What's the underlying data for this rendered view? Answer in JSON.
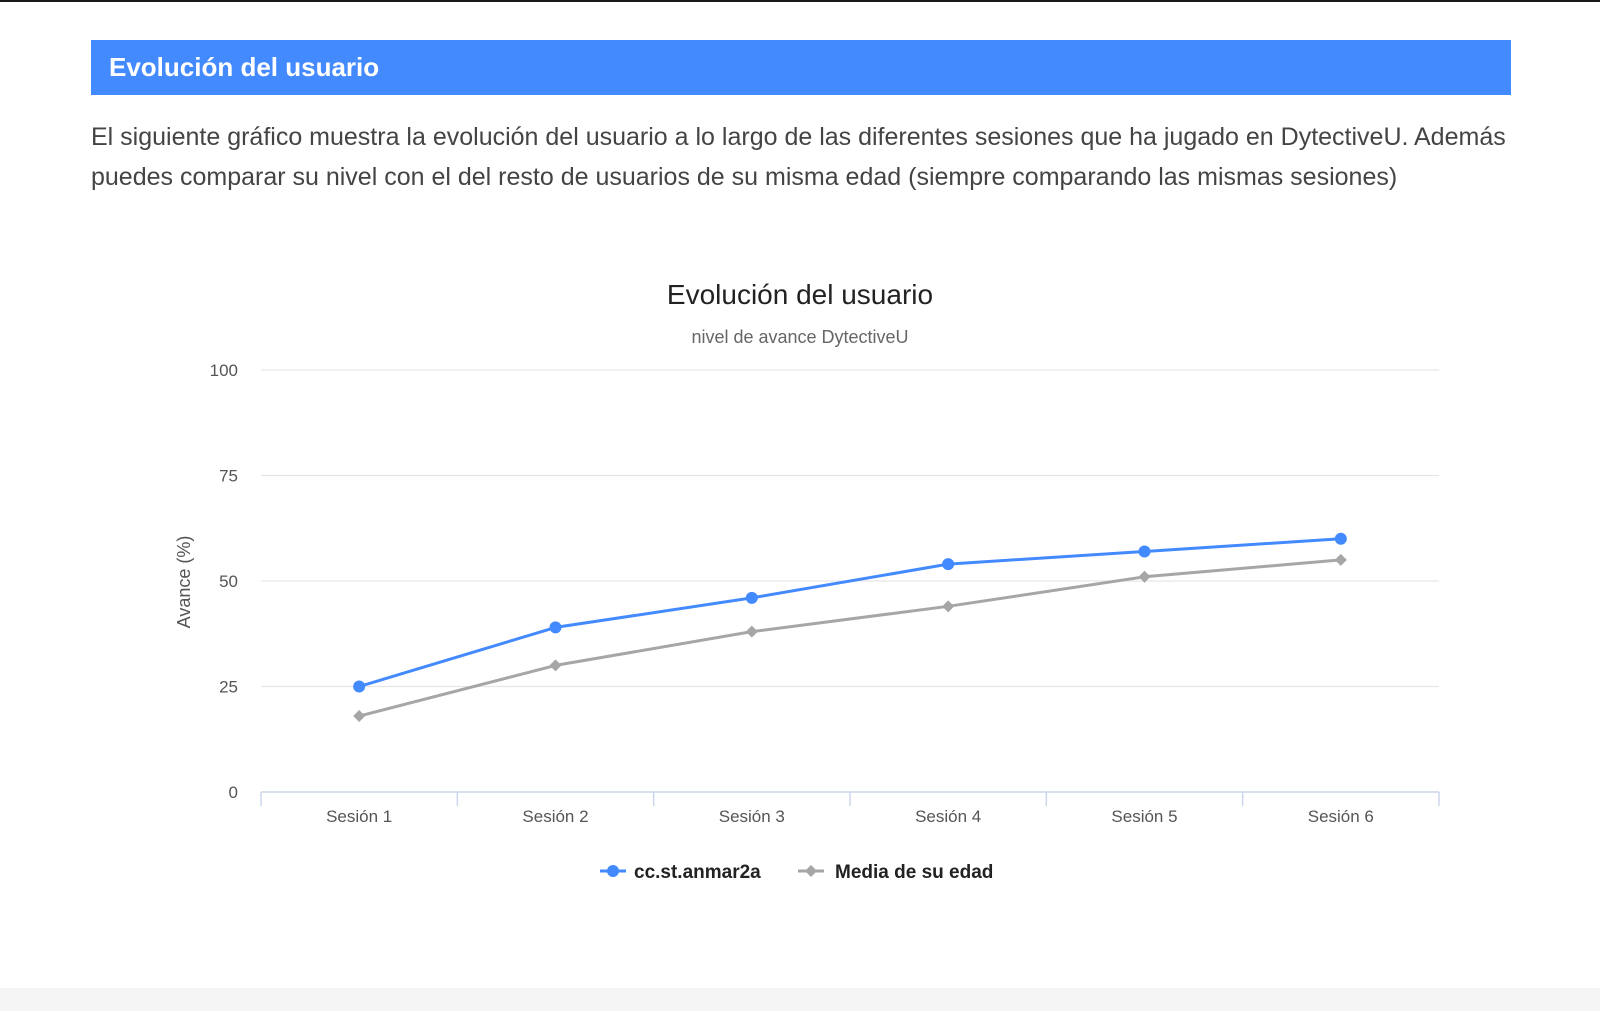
{
  "header": {
    "title": "Evolución del usuario"
  },
  "description": "El siguiente gráfico muestra la evolución del usuario a lo largo de las diferentes sesiones que ha jugado en DytectiveU. Además puedes comparar su nivel con el del resto de usuarios de su misma edad (siempre comparando las mismas sesiones)",
  "colors": {
    "header_bg": "#448aff",
    "series_user": "#448aff",
    "series_avg": "#a6a6a6",
    "grid": "#e6e6e6"
  },
  "chart_data": {
    "type": "line",
    "title": "Evolución del usuario",
    "subtitle": "nivel de avance DytectiveU",
    "xlabel": "",
    "ylabel": "Avance (%)",
    "ylim": [
      0,
      100
    ],
    "yticks": [
      "0",
      "25",
      "50",
      "75",
      "100"
    ],
    "categories": [
      "Sesión 1",
      "Sesión 2",
      "Sesión 3",
      "Sesión 4",
      "Sesión 5",
      "Sesión 6"
    ],
    "grid": true,
    "legend_position": "bottom",
    "series": [
      {
        "name": "cc.st.anmar2a",
        "marker": "circle",
        "color": "#448aff",
        "values": [
          25,
          39,
          46,
          54,
          57,
          60
        ]
      },
      {
        "name": "Media de su edad",
        "marker": "diamond",
        "color": "#a6a6a6",
        "values": [
          18,
          30,
          38,
          44,
          51,
          55
        ]
      }
    ]
  }
}
